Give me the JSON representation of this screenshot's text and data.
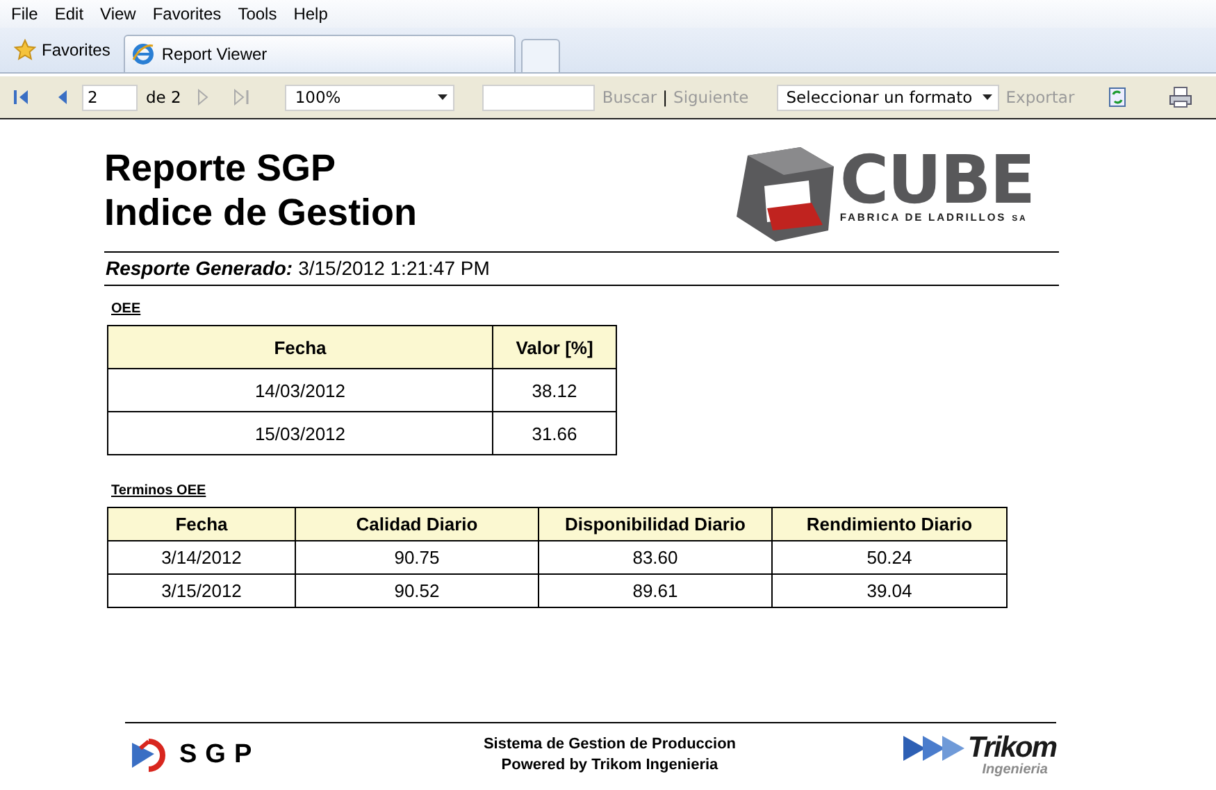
{
  "menu": [
    "File",
    "Edit",
    "View",
    "Favorites",
    "Tools",
    "Help"
  ],
  "favorites": "Favorites",
  "tabs": [
    {
      "label": "Report Viewer",
      "selected": true
    }
  ],
  "toolbar": {
    "page": "2",
    "page_total": "de 2",
    "zoom": "100%",
    "find": {
      "label": "Buscar",
      "disabled": true
    },
    "separator": "|",
    "next": {
      "label": "Siguiente",
      "disabled": true
    },
    "format": "Seleccionar un formato",
    "export": {
      "label": "Exportar",
      "disabled": true
    }
  },
  "report": {
    "title_lines": [
      "Reporte SGP",
      "Indice de Gestion"
    ],
    "logo": {
      "name": "CUBE",
      "subtitle": "FABRICA DE LADRILLOS",
      "suffix": "SA"
    },
    "generated": {
      "label": "Resporte Generado:",
      "value": "3/15/2012 1:21:47 PM"
    },
    "sections": [
      {
        "heading": "OEE",
        "columns": [
          "Fecha",
          "Valor [%]"
        ],
        "rows": [
          [
            "14/03/2012",
            "38.12"
          ],
          [
            "15/03/2012",
            "31.66"
          ]
        ]
      },
      {
        "heading": "Terminos OEE",
        "columns": [
          "Fecha",
          "Calidad Diario",
          "Disponibilidad Diario",
          "Rendimiento Diario"
        ],
        "rows": [
          [
            "3/14/2012",
            "90.75",
            "83.60",
            "50.24"
          ],
          [
            "3/15/2012",
            "90.52",
            "89.61",
            "39.04"
          ]
        ]
      }
    ],
    "footer": {
      "left_logo": "SGP",
      "lines": [
        "Sistema de Gestion de Produccion",
        "Powered by Trikom Ingenieria"
      ],
      "right_logo": {
        "name": "Trikom",
        "subtitle": "Ingenieria"
      }
    }
  }
}
